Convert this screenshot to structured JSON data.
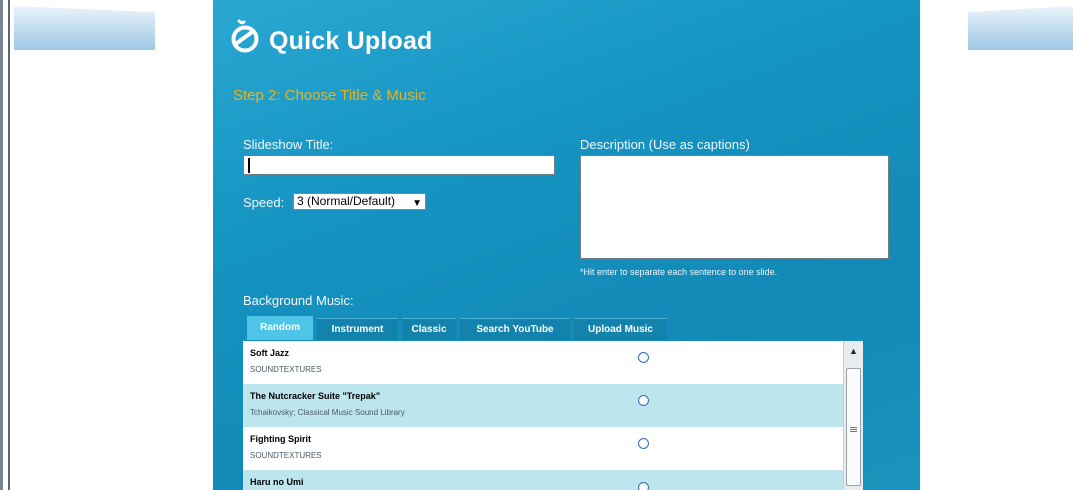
{
  "app": {
    "title": "Quick Upload",
    "logo_icon": "quick-upload-logo-icon",
    "accent_color": "#1593c1"
  },
  "step": {
    "title": "Step 2: Choose Title & Music",
    "color": "#e8b21c"
  },
  "form": {
    "title_label": "Slideshow Title:",
    "title_value": "",
    "speed_label": "Speed:",
    "speed_value": "3 (Normal/Default)",
    "description_label": "Description (Use as captions)",
    "description_value": "",
    "description_hint": "*Hit enter to separate each sentence to one slide."
  },
  "music": {
    "label": "Background Music:",
    "tabs": [
      {
        "label": "Random",
        "active": true
      },
      {
        "label": "Instrument",
        "active": false
      },
      {
        "label": "Classic",
        "active": false
      },
      {
        "label": "Search YouTube",
        "active": false
      },
      {
        "label": "Upload Music",
        "active": false
      }
    ],
    "tracks": [
      {
        "name": "Soft Jazz",
        "artist": "SOUNDTEXTURES",
        "selected": false
      },
      {
        "name": "The Nutcracker Suite \"Trepak\"",
        "artist": "Tchaikovsky; Classical Music Sound Library",
        "selected": false
      },
      {
        "name": "Fighting Spirit",
        "artist": "SOUNDTEXTURES",
        "selected": false
      },
      {
        "name": "Haru no Umi",
        "artist": "",
        "selected": false
      }
    ]
  }
}
